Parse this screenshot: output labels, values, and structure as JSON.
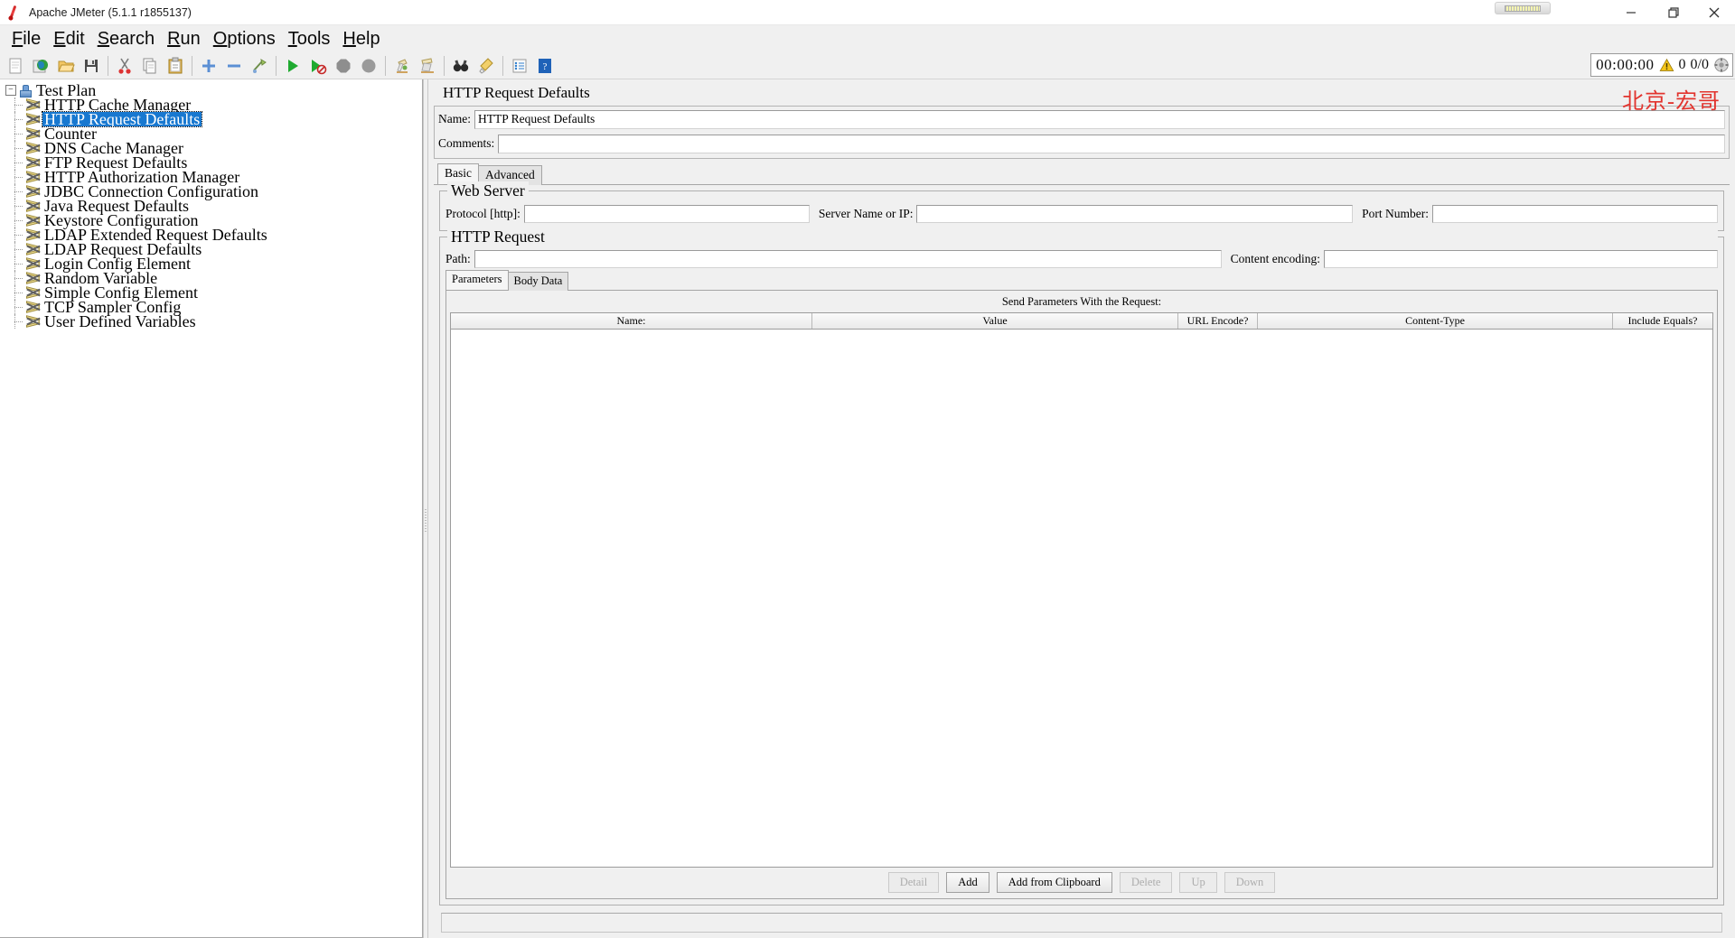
{
  "window": {
    "title": "Apache JMeter (5.1.1 r1855137)",
    "app_icon": "feather-icon",
    "minimize": "minimize-button",
    "maximize": "maximize-button",
    "close": "close-button"
  },
  "menubar": [
    {
      "label": "File",
      "mnemonic": "F"
    },
    {
      "label": "Edit",
      "mnemonic": "E"
    },
    {
      "label": "Search",
      "mnemonic": "S"
    },
    {
      "label": "Run",
      "mnemonic": "R"
    },
    {
      "label": "Options",
      "mnemonic": "O"
    },
    {
      "label": "Tools",
      "mnemonic": "T"
    },
    {
      "label": "Help",
      "mnemonic": "H"
    }
  ],
  "toolbar": {
    "buttons": [
      {
        "name": "new-icon",
        "title": "New"
      },
      {
        "name": "templates-icon",
        "title": "Templates"
      },
      {
        "name": "open-icon",
        "title": "Open"
      },
      {
        "name": "save-icon",
        "title": "Save Test Plan"
      },
      {
        "name": "cut-icon",
        "title": "Cut"
      },
      {
        "name": "copy-icon",
        "title": "Copy"
      },
      {
        "name": "paste-icon",
        "title": "Paste"
      },
      {
        "name": "expand-all-icon",
        "title": "Expand All"
      },
      {
        "name": "collapse-all-icon",
        "title": "Collapse All"
      },
      {
        "name": "toggle-icon",
        "title": "Toggle"
      },
      {
        "name": "start-icon",
        "title": "Start"
      },
      {
        "name": "start-no-pauses-icon",
        "title": "Start no pauses"
      },
      {
        "name": "stop-icon",
        "title": "Stop"
      },
      {
        "name": "shutdown-icon",
        "title": "Shutdown"
      },
      {
        "name": "clear-icon",
        "title": "Clear"
      },
      {
        "name": "clear-all-icon",
        "title": "Clear All"
      },
      {
        "name": "search-icon",
        "title": "Search"
      },
      {
        "name": "search-reset-icon",
        "title": "Reset Search"
      },
      {
        "name": "function-helper-icon",
        "title": "Function Helper Dialog"
      },
      {
        "name": "help-icon",
        "title": "Help"
      }
    ],
    "status": {
      "timer": "00:00:00",
      "warning_icon": "warning-triangle-icon",
      "warning_count": "0",
      "threads": "0/0",
      "connection_icon": "connection-icon"
    }
  },
  "tree": {
    "root": {
      "label": "Test Plan",
      "icon": "test-plan-icon",
      "expanded": true
    },
    "items": [
      {
        "label": "HTTP Cache Manager",
        "icon": "config-element-icon",
        "selected": false
      },
      {
        "label": "HTTP Request Defaults",
        "icon": "config-element-icon",
        "selected": true
      },
      {
        "label": "Counter",
        "icon": "config-element-icon",
        "selected": false
      },
      {
        "label": "DNS Cache Manager",
        "icon": "config-element-icon",
        "selected": false
      },
      {
        "label": "FTP Request Defaults",
        "icon": "config-element-icon",
        "selected": false
      },
      {
        "label": "HTTP Authorization Manager",
        "icon": "config-element-icon",
        "selected": false
      },
      {
        "label": "JDBC Connection Configuration",
        "icon": "config-element-icon",
        "selected": false
      },
      {
        "label": "Java Request Defaults",
        "icon": "config-element-icon",
        "selected": false
      },
      {
        "label": "Keystore Configuration",
        "icon": "config-element-icon",
        "selected": false
      },
      {
        "label": "LDAP Extended Request Defaults",
        "icon": "config-element-icon",
        "selected": false
      },
      {
        "label": "LDAP Request Defaults",
        "icon": "config-element-icon",
        "selected": false
      },
      {
        "label": "Login Config Element",
        "icon": "config-element-icon",
        "selected": false
      },
      {
        "label": "Random Variable",
        "icon": "config-element-icon",
        "selected": false
      },
      {
        "label": "Simple Config Element",
        "icon": "config-element-icon",
        "selected": false
      },
      {
        "label": "TCP Sampler Config",
        "icon": "config-element-icon",
        "selected": false
      },
      {
        "label": "User Defined Variables",
        "icon": "config-element-icon",
        "selected": false
      }
    ]
  },
  "main": {
    "panel_title": "HTTP Request Defaults",
    "watermark": "北京-宏哥",
    "name_label": "Name:",
    "name_value": "HTTP Request Defaults",
    "comments_label": "Comments:",
    "comments_value": "",
    "tabs": [
      {
        "label": "Basic",
        "active": true
      },
      {
        "label": "Advanced",
        "active": false
      }
    ],
    "web_server": {
      "title": "Web Server",
      "protocol_label": "Protocol [http]:",
      "protocol_value": "",
      "server_label": "Server Name or IP:",
      "server_value": "",
      "port_label": "Port Number:",
      "port_value": ""
    },
    "http_request": {
      "title": "HTTP Request",
      "path_label": "Path:",
      "path_value": "",
      "encoding_label": "Content encoding:",
      "encoding_value": "",
      "inner_tabs": [
        {
          "label": "Parameters",
          "active": true
        },
        {
          "label": "Body Data",
          "active": false
        }
      ],
      "send_caption": "Send Parameters With the Request:",
      "table": {
        "columns": [
          "Name:",
          "Value",
          "URL Encode?",
          "Content-Type",
          "Include Equals?"
        ],
        "rows": []
      },
      "buttons": [
        {
          "label": "Detail",
          "enabled": false
        },
        {
          "label": "Add",
          "enabled": true
        },
        {
          "label": "Add from Clipboard",
          "enabled": true
        },
        {
          "label": "Delete",
          "enabled": false
        },
        {
          "label": "Up",
          "enabled": false
        },
        {
          "label": "Down",
          "enabled": false
        }
      ]
    }
  },
  "colors": {
    "selection": "#1878d0",
    "watermark": "#e2342e",
    "panel_bg": "#f0f0f0",
    "field_bg": "#ffffff"
  }
}
